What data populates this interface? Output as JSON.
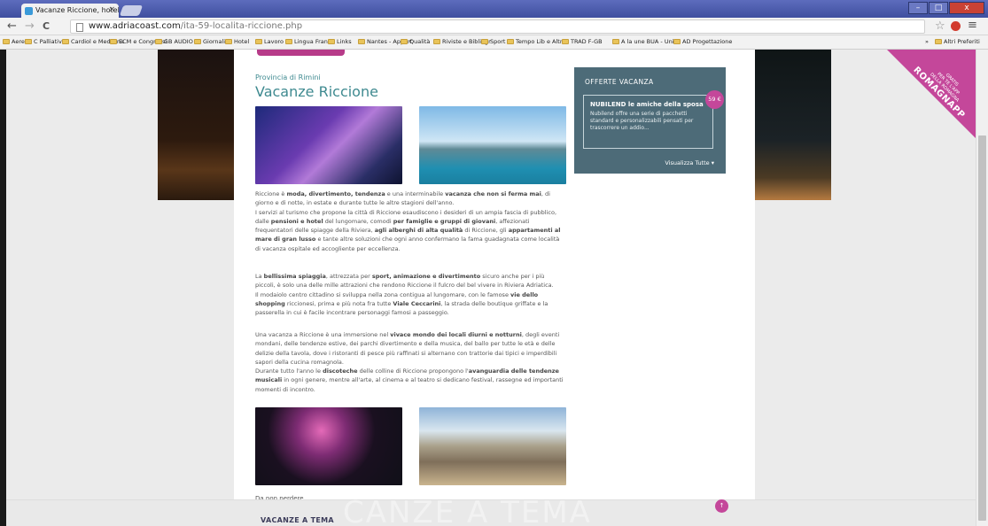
{
  "browser": {
    "tab_title": "Vacanze Riccione, hotel Ri",
    "tab_close": "×",
    "url_domain": "www.adriacoast.com",
    "url_path": "/ita-59-localita-riccione.php",
    "back": "←",
    "forward": "→",
    "reload": "C",
    "star": "☆",
    "menu": "≡",
    "window_min": "–",
    "window_max": "□",
    "window_close": "x"
  },
  "bookmarks": [
    "Aerei",
    "C Palliative",
    "Cardiol e Medicina",
    "ECM e Congressi",
    "GB AUDIO",
    "Giornali",
    "Hotel",
    "Lavoro",
    "Lingua Franc",
    "Links",
    "Nantes - Appart",
    "Qualità",
    "Riviste e Bibliogr",
    "Sport",
    "Tempo Lib e Altro",
    "TRAD F-GB",
    "A la une  BUA - Unive",
    "AD Progettazione"
  ],
  "bookmarks_more": "»",
  "bookmarks_other": "Altri Preferiti",
  "article": {
    "provincia": "Provincia di Rimini",
    "title": "Vacanze Riccione",
    "p1_a": "Riccione è ",
    "p1_b": "moda, divertimento, tendenza",
    "p1_c": " e una interminabile ",
    "p1_d": "vacanza che non si ferma mai",
    "p1_e": ", di giorno e di notte, in estate e durante tutte le altre stagioni dell'anno.",
    "p1_f": "I servizi al turismo che propone la città di Riccione esaudiscono i desideri di un ampia fascia di pubblico, dalle ",
    "p1_g": "pensioni e hotel",
    "p1_h": " del lungomare, comodi ",
    "p1_i": "per famiglie e gruppi di giovani",
    "p1_j": ", affezionati frequentatori delle spiagge della Riviera, ",
    "p1_k": "agli alberghi di alta qualità",
    "p1_l": " di Riccione, gli ",
    "p1_m": "appartamenti al mare di gran lusso",
    "p1_n": " e tante altre soluzioni che ogni anno confermano la fama guadagnata come località di vacanza ospitale ed accogliente per eccellenza.",
    "p2_a": "La ",
    "p2_b": "bellissima spiaggia",
    "p2_c": ", attrezzata per ",
    "p2_d": "sport, animazione e divertimento",
    "p2_e": " sicuro anche per i più piccoli, è solo una delle mille attrazioni che rendono Riccione il fulcro del bel vivere in Riviera Adriatica.",
    "p2_f": "Il modaiolo centro cittadino si sviluppa nella zona contigua al lungomare, con le famose ",
    "p2_g": "vie dello shopping",
    "p2_h": " riccionesi, prima e più nota fra tutte ",
    "p2_i": "Viale Ceccarini",
    "p2_j": ", la strada delle boutique griffate e la passerella in cui è facile incontrare personaggi famosi a passeggio.",
    "p3_a": "Una vacanza a Riccione è una immersione nel ",
    "p3_b": "vivace mondo dei locali diurni e notturni",
    "p3_c": ", degli eventi mondani, delle tendenze estive, dei parchi divertimento e della musica, del ballo per tutte le età e delle delizie della tavola, dove i ristoranti di pesce più raffinati si alternano con trattorie dai tipici e imperdibili sapori della cucina romagnola.",
    "p3_d": "Durante tutto l'anno le ",
    "p3_e": "discoteche",
    "p3_f": " delle colline di Riccione propongono l'",
    "p3_g": "avanguardia delle tendenze musicali",
    "p3_h": " in ogni genere, mentre all'arte, al cinema e al teatro si dedicano festival, rassegne ed importanti momenti di incontro.",
    "da_non_perdere": "Da non perdere..."
  },
  "offerte": {
    "title": "OFFERTE VACANZA",
    "card_title": "NUBILEND le amiche della sposa",
    "card_desc": "Nubilend offre una serie di pacchetti standard e personalizzabili pensati per trascorrere un addio...",
    "price": "59 €",
    "see_all": "Visualizza Tutte ▾"
  },
  "ribbon": {
    "line1": "GRATIS",
    "line2": "PER TE L'APP",
    "line3": "DELLA ROMAGNA",
    "brand": "ROMAGNAPP"
  },
  "footer": {
    "ghost": "CANZE A TEMA",
    "label": "VACANZE A TEMA",
    "up": "↑"
  }
}
